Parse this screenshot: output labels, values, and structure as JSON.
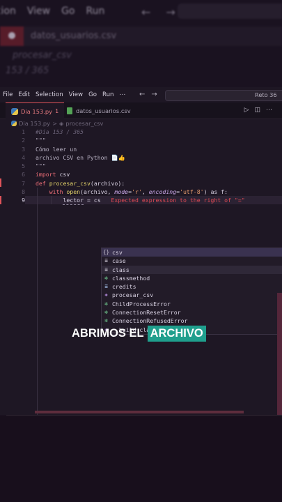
{
  "blurred_header": {
    "menu": [
      "tion",
      "View",
      "Go",
      "Run"
    ],
    "tab_file": "datos_usuarios.csv",
    "crumb": "procesar_csv",
    "line_comment": "153 / 365"
  },
  "menubar": {
    "items": [
      "File",
      "Edit",
      "Selection",
      "View",
      "Go",
      "Run",
      "⋯"
    ],
    "search_text": "Reto 36"
  },
  "tabs": [
    {
      "label": "Dia 153.py",
      "modified": "1"
    },
    {
      "label": "datos_usuarios.csv"
    }
  ],
  "breadcrumb": {
    "file": "Dia 153.py",
    "sep": ">",
    "symbol": "procesar_csv"
  },
  "code": {
    "line_numbers": [
      "1",
      "2",
      "3",
      "4",
      "5",
      "6",
      "7",
      "8",
      "9"
    ],
    "l1": "#Día 153 / 365",
    "l2": "\"\"\"",
    "l3": "Cómo leer un",
    "l4": "archivo CSV en Python 📄👍",
    "l5": "\"\"\"",
    "l6_kw": "import",
    "l6_rest": " csv",
    "l7_kw": "def",
    "l7_fn": "procesar_csv",
    "l7_rest": "(archivo):",
    "l8_kw": "with",
    "l8_fn": "open",
    "l8_a": "(archivo, ",
    "l8_p1": "mode",
    "l8_eq1": "=",
    "l8_s1": "'r'",
    "l8_c": ", ",
    "l8_p2": "encoding",
    "l8_eq2": "=",
    "l8_s2": "'utf-8'",
    "l8_b": ") as f:",
    "l9_code": "lector = cs",
    "l9_err": "Expected expression to the right of \"=\""
  },
  "suggestions": [
    {
      "icon": "{}",
      "text": "csv"
    },
    {
      "icon": "≣",
      "text": "case"
    },
    {
      "icon": "≣",
      "text": "class"
    },
    {
      "icon": "❇",
      "text": "classmethod"
    },
    {
      "icon": "≣",
      "text": "credits"
    },
    {
      "icon": "◈",
      "text": "procesar_csv"
    },
    {
      "icon": "❇",
      "text": "ChildProcessError"
    },
    {
      "icon": "❇",
      "text": "ConnectionResetError"
    },
    {
      "icon": "❇",
      "text": "ConnectionRefusedError"
    },
    {
      "icon": "◈",
      "text": "__build_class__"
    }
  ],
  "caption": {
    "part1": "ABRIMOS EL",
    "part2": "ARCHIVO"
  },
  "colors": {
    "accent": "#1f9f8d",
    "error": "#e24a55",
    "keyword": "#ef6f78"
  }
}
